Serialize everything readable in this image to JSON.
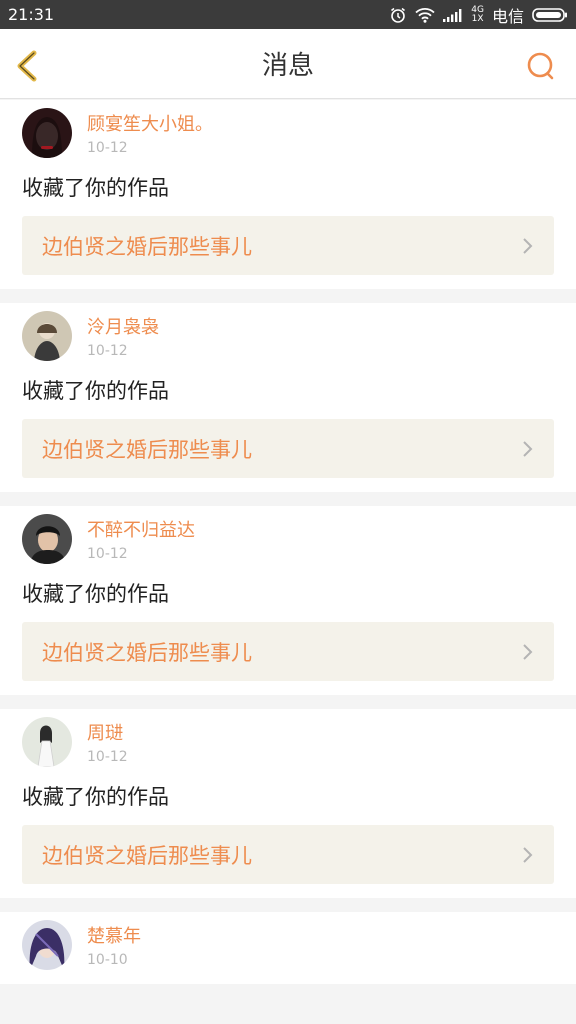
{
  "status_bar": {
    "time": "21:31",
    "network_top": "4G",
    "network_bottom": "1X",
    "carrier": "电信",
    "icons": [
      "alarm-icon",
      "wifi-icon",
      "signal-icon",
      "battery-icon"
    ]
  },
  "header": {
    "title": "消息",
    "back_icon": "back-chevron-icon",
    "search_icon": "search-icon"
  },
  "colors": {
    "accent": "#ee8c4e",
    "back_icon": "#e2b84a",
    "link_bg": "#f4f2ea"
  },
  "messages": [
    {
      "user": "顾宴笙大小姐。",
      "date": "10-12",
      "action": "收藏了你的作品",
      "work": "边伯贤之婚后那些事儿"
    },
    {
      "user": "泠月袅袅",
      "date": "10-12",
      "action": "收藏了你的作品",
      "work": "边伯贤之婚后那些事儿"
    },
    {
      "user": "不醉不归益达",
      "date": "10-12",
      "action": "收藏了你的作品",
      "work": "边伯贤之婚后那些事儿"
    },
    {
      "user": "周琎",
      "date": "10-12",
      "action": "收藏了你的作品",
      "work": "边伯贤之婚后那些事儿"
    },
    {
      "user": "楚慕年",
      "date": "10-10",
      "action": "",
      "work": ""
    }
  ]
}
